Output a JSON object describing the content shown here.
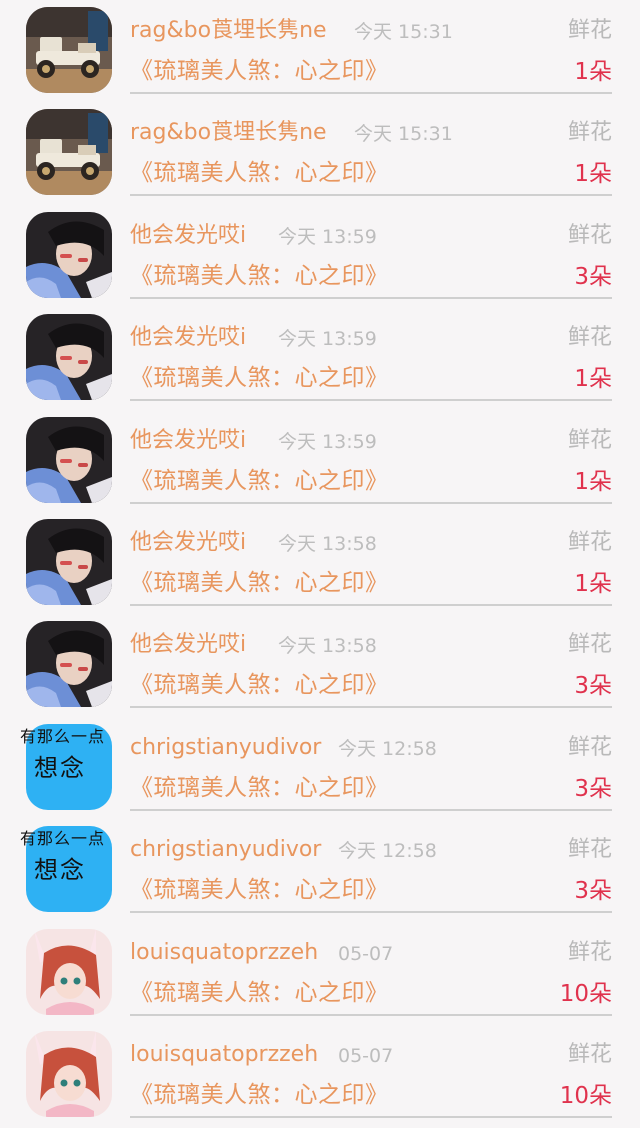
{
  "items": [
    {
      "user": "rag&bo莨埋长隽ne",
      "time": "今天 15:31",
      "type": "鲜花",
      "book": "《琉璃美人煞：心之印》",
      "count": "1朵",
      "avatar": "car-avatar"
    },
    {
      "user": "rag&bo莨埋长隽ne",
      "time": "今天 15:31",
      "type": "鲜花",
      "book": "《琉璃美人煞：心之印》",
      "count": "1朵",
      "avatar": "car-avatar"
    },
    {
      "user": "他会发光哎i",
      "time": "今天 13:59",
      "type": "鲜花",
      "book": "《琉璃美人煞：心之印》",
      "count": "3朵",
      "avatar": "person-avatar"
    },
    {
      "user": "他会发光哎i",
      "time": "今天 13:59",
      "type": "鲜花",
      "book": "《琉璃美人煞：心之印》",
      "count": "1朵",
      "avatar": "person-avatar"
    },
    {
      "user": "他会发光哎i",
      "time": "今天 13:59",
      "type": "鲜花",
      "book": "《琉璃美人煞：心之印》",
      "count": "1朵",
      "avatar": "person-avatar"
    },
    {
      "user": "他会发光哎i",
      "time": "今天 13:58",
      "type": "鲜花",
      "book": "《琉璃美人煞：心之印》",
      "count": "1朵",
      "avatar": "person-avatar"
    },
    {
      "user": "他会发光哎i",
      "time": "今天 13:58",
      "type": "鲜花",
      "book": "《琉璃美人煞：心之印》",
      "count": "3朵",
      "avatar": "person-avatar"
    },
    {
      "user": "chrigstianyudivor",
      "time": "今天 12:58",
      "type": "鲜花",
      "book": "《琉璃美人煞：心之印》",
      "count": "3朵",
      "avatar": "text-avatar",
      "avatar_text_top": "有那么一点",
      "avatar_text_main": "想念"
    },
    {
      "user": "chrigstianyudivor",
      "time": "今天 12:58",
      "type": "鲜花",
      "book": "《琉璃美人煞：心之印》",
      "count": "3朵",
      "avatar": "text-avatar",
      "avatar_text_top": "有那么一点",
      "avatar_text_main": "想念"
    },
    {
      "user": "louisquatoprzzeh",
      "time": "05-07",
      "type": "鲜花",
      "book": "《琉璃美人煞：心之印》",
      "count": "10朵",
      "avatar": "anime-avatar"
    },
    {
      "user": "louisquatoprzzeh",
      "time": "05-07",
      "type": "鲜花",
      "book": "《琉璃美人煞：心之印》",
      "count": "10朵",
      "avatar": "anime-avatar"
    }
  ]
}
